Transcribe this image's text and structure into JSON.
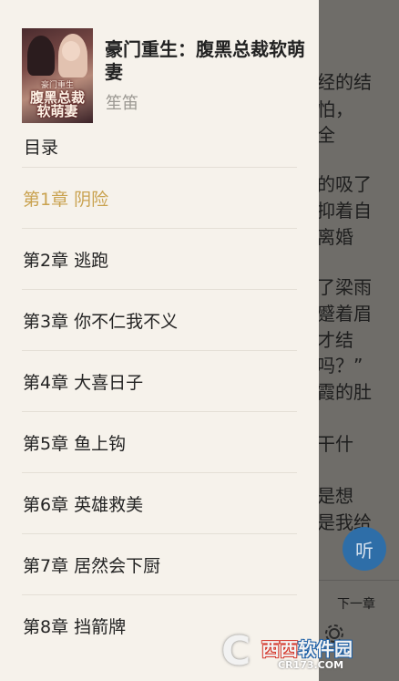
{
  "reader": {
    "lines": [
      "经的结",
      "怕，",
      "全",
      "的吸了",
      "抑着自",
      "离婚",
      "了梁雨",
      "蹙着眉",
      "才结",
      "吗？”",
      "霞的肚",
      "干什",
      "是想",
      "是我给"
    ],
    "listen_label": "听",
    "next_chapter_label": "下一章"
  },
  "drawer": {
    "book": {
      "cover_text_top": "豪门重生",
      "cover_text_main": "腹黑总裁",
      "cover_text_sub": "软萌妻",
      "title": "豪门重生：腹黑总裁软萌妻",
      "author": "笙笛"
    },
    "toc_header": "目录",
    "chapters": [
      {
        "label": "第1章 阴险",
        "active": true
      },
      {
        "label": "第2章 逃跑",
        "active": false
      },
      {
        "label": "第3章 你不仁我不义",
        "active": false
      },
      {
        "label": "第4章 大喜日子",
        "active": false
      },
      {
        "label": "第5章 鱼上钩",
        "active": false
      },
      {
        "label": "第6章 英雄救美",
        "active": false
      },
      {
        "label": "第7章 居然会下厨",
        "active": false
      },
      {
        "label": "第8章 挡箭牌",
        "active": false
      }
    ]
  },
  "watermark": {
    "brand_red": "西西",
    "brand_blue": "软件园",
    "url": "CR173.COM"
  },
  "colors": {
    "active_chapter": "#c9a24f",
    "drawer_bg": "#f6f2eb",
    "listen_button": "#2e6ea8"
  }
}
